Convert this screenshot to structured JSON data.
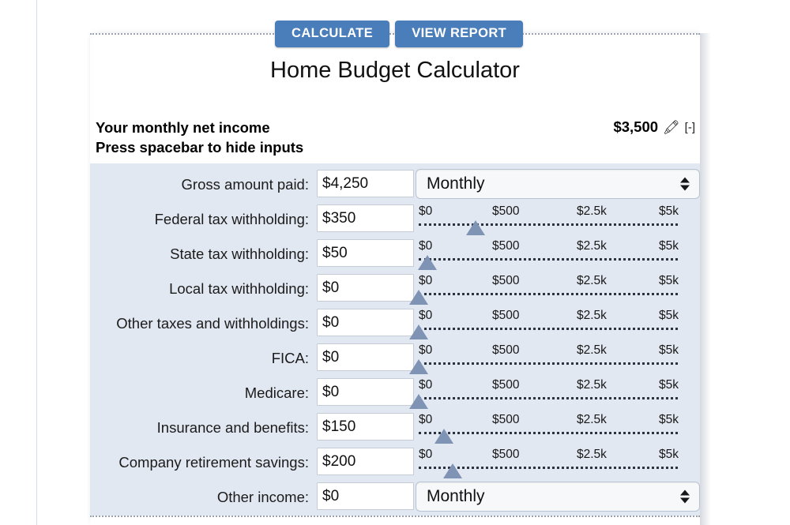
{
  "toolbar": {
    "calculate_label": "CALCULATE",
    "view_report_label": "VIEW REPORT",
    "accent_color": "#4a7ebb"
  },
  "title": "Home Budget Calculator",
  "summary": {
    "line1": "Your monthly net income",
    "line2": "Press spacebar to hide inputs",
    "net_income": "$3,500",
    "edit_icon": "pencil-icon",
    "collapse_label": "[-]"
  },
  "panel": {
    "background_color": "#e2e8f2",
    "slider_ticks": [
      "$0",
      "$500",
      "$2.5k",
      "$5k"
    ],
    "rows": [
      {
        "label": "Gross amount paid:",
        "value": "$4,250",
        "control": "select",
        "select_value": "Monthly"
      },
      {
        "label": "Federal tax withholding:",
        "value": "$350",
        "control": "slider",
        "handle_pct": 22.0
      },
      {
        "label": "State tax withholding:",
        "value": "$50",
        "control": "slider",
        "handle_pct": 3.4
      },
      {
        "label": "Local tax withholding:",
        "value": "$0",
        "control": "slider",
        "handle_pct": 0.0
      },
      {
        "label": "Other taxes and withholdings:",
        "value": "$0",
        "control": "slider",
        "handle_pct": 0.0
      },
      {
        "label": "FICA:",
        "value": "$0",
        "control": "slider",
        "handle_pct": 0.0
      },
      {
        "label": "Medicare:",
        "value": "$0",
        "control": "slider",
        "handle_pct": 0.0
      },
      {
        "label": "Insurance and benefits:",
        "value": "$150",
        "control": "slider",
        "handle_pct": 9.8
      },
      {
        "label": "Company retirement savings:",
        "value": "$200",
        "control": "slider",
        "handle_pct": 13.0
      },
      {
        "label": "Other income:",
        "value": "$0",
        "control": "select",
        "select_value": "Monthly"
      }
    ]
  }
}
